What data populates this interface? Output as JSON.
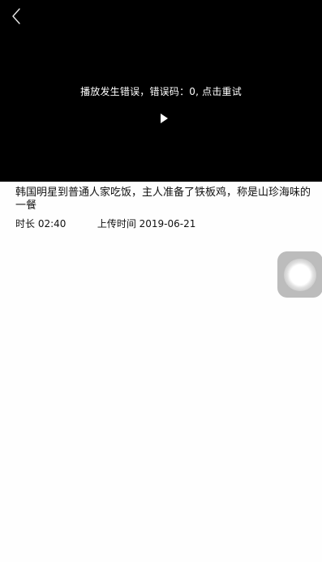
{
  "player": {
    "error_message": "播放发生错误，错误码：0, 点击重试",
    "back_icon": "chevron-left-icon",
    "play_icon": "play-icon"
  },
  "video": {
    "title": "韩国明星到普通人家吃饭，主人准备了铁板鸡，称是山珍海味的一餐",
    "duration": "时长 02:40",
    "upload_time": "上传时间 2019-06-21"
  },
  "assistive_touch": {
    "icon": "assistive-touch-icon"
  },
  "colors": {
    "player_background": "#000000",
    "page_background": "#fefefe",
    "text": "#111111"
  }
}
